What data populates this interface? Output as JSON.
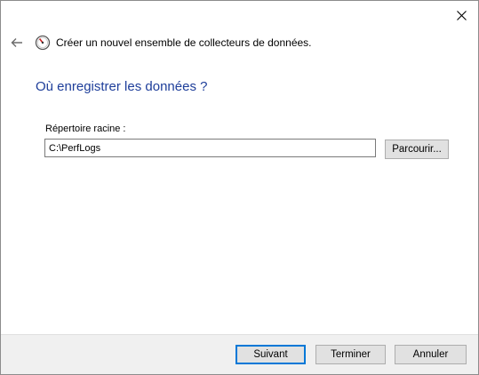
{
  "window": {
    "header_title": "Créer un nouvel ensemble de collecteurs de données."
  },
  "page": {
    "title": "Où enregistrer les données ?",
    "root_dir_label": "Répertoire racine :",
    "root_dir_value": "C:\\PerfLogs",
    "browse_label": "Parcourir..."
  },
  "footer": {
    "next_label": "Suivant",
    "finish_label": "Terminer",
    "cancel_label": "Annuler"
  },
  "icons": {
    "close": "close-icon",
    "back": "back-arrow-icon",
    "wizard": "performance-gauge-icon"
  },
  "colors": {
    "title_blue": "#1e3e9a",
    "default_button_border": "#0078d7",
    "footer_bg": "#f0f0f0"
  }
}
